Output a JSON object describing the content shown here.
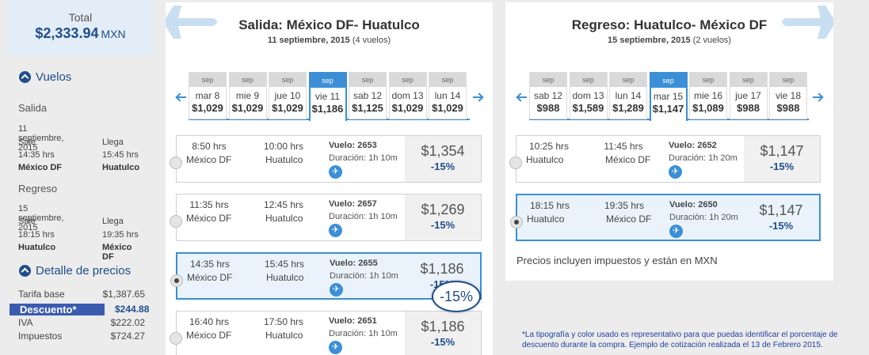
{
  "sidebar": {
    "total_label": "Total",
    "total_amount": "$2,333.94",
    "total_currency": "MXN",
    "vuelos_title": "Vuelos",
    "salida": {
      "title": "Salida",
      "date": "11  septiembre, 2015",
      "sale_label": "Sale",
      "llega_label": "Llega",
      "dep_time": "14:35 hrs",
      "arr_time": "15:45 hrs",
      "from": "México DF",
      "to": "Huatulco"
    },
    "regreso": {
      "title": "Regreso",
      "date": "15  septiembre, 2015",
      "sale_label": "Sale",
      "llega_label": "Llega",
      "dep_time": "18:15 hrs",
      "arr_time": "19:35 hrs",
      "from": "Huatulco",
      "to": "México DF"
    },
    "detalle_title": "Detalle de precios",
    "prices": {
      "tarifa_label": "Tarifa base",
      "tarifa_value": "$1,387.65",
      "descuento_label": "Descuento*",
      "descuento_value": "$244.88",
      "iva_label": "IVA",
      "iva_value": "$222.02",
      "impuestos_label": "Impuestos",
      "impuestos_value": "$724.27"
    }
  },
  "outbound": {
    "title": "Salida:  México DF- Huatulco",
    "date": "11  septiembre, 2015",
    "count": "(4 vuelos)",
    "dates": [
      {
        "month": "sep",
        "day": "mar 8",
        "price": "$1,029"
      },
      {
        "month": "sep",
        "day": "mie 9",
        "price": "$1,029"
      },
      {
        "month": "sep",
        "day": "jue 10",
        "price": "$1,029"
      },
      {
        "month": "sep",
        "day": "vie 11",
        "price": "$1,186"
      },
      {
        "month": "sep",
        "day": "sab 12",
        "price": "$1,125"
      },
      {
        "month": "sep",
        "day": "dom 13",
        "price": "$1,029"
      },
      {
        "month": "sep",
        "day": "lun 14",
        "price": "$1,029"
      }
    ],
    "flights": [
      {
        "dep": "8:50 hrs",
        "arr": "10:00 hrs",
        "from": "México DF",
        "to": "Huatulco",
        "flight": "Vuelo: 2653",
        "duration": "Duración: 1h 10m",
        "price": "$1,354",
        "discount": "-15%"
      },
      {
        "dep": "11:35 hrs",
        "arr": "12:45 hrs",
        "from": "México DF",
        "to": "Huatulco",
        "flight": "Vuelo: 2657",
        "duration": "Duración: 1h 10m",
        "price": "$1,269",
        "discount": "-15%"
      },
      {
        "dep": "14:35 hrs",
        "arr": "15:45 hrs",
        "from": "México DF",
        "to": "Huatulco",
        "flight": "Vuelo: 2655",
        "duration": "Duración: 1h 10m",
        "price": "$1,186",
        "discount": "-15%"
      },
      {
        "dep": "16:40 hrs",
        "arr": "17:50 hrs",
        "from": "México DF",
        "to": "Huatulco",
        "flight": "Vuelo: 2651",
        "duration": "Duración: 1h 10m",
        "price": "$1,186",
        "discount": "-15%"
      }
    ]
  },
  "return": {
    "title": "Regreso:  Huatulco- México DF",
    "date": "15  septiembre, 2015",
    "count": "(2 vuelos)",
    "dates": [
      {
        "month": "sep",
        "day": "sab 12",
        "price": "$988"
      },
      {
        "month": "sep",
        "day": "dom 13",
        "price": "$1,589"
      },
      {
        "month": "sep",
        "day": "lun 14",
        "price": "$1,289"
      },
      {
        "month": "sep",
        "day": "mar 15",
        "price": "$1,147"
      },
      {
        "month": "sep",
        "day": "mie 16",
        "price": "$1,089"
      },
      {
        "month": "sep",
        "day": "jue 17",
        "price": "$988"
      },
      {
        "month": "sep",
        "day": "vie 18",
        "price": "$988"
      }
    ],
    "flights": [
      {
        "dep": "10:25 hrs",
        "arr": "11:45 hrs",
        "from": "Huatulco",
        "to": "México DF",
        "flight": "Vuelo: 2652",
        "duration": "Duración: 1h 20m",
        "price": "$1,147",
        "discount": "-15%"
      },
      {
        "dep": "18:15 hrs",
        "arr": "19:35 hrs",
        "from": "Huatulco",
        "to": "México DF",
        "flight": "Vuelo: 2650",
        "duration": "Duración: 1h 20m",
        "price": "$1,147",
        "discount": "-15%"
      }
    ],
    "note": "Precios incluyen impuestos y están en MXN"
  },
  "badge_text": "-15%",
  "footnote": "*La tipografía y color usado es representativo para que puedas identificar el porcentaje de descuento durante la compra. Ejemplo de cotización realizada el 13 de Febrero 2015.",
  "colors": {
    "accent": "#3b8fd6",
    "brand": "#1f4e8c",
    "discount_bar": "#3b5bb0"
  }
}
